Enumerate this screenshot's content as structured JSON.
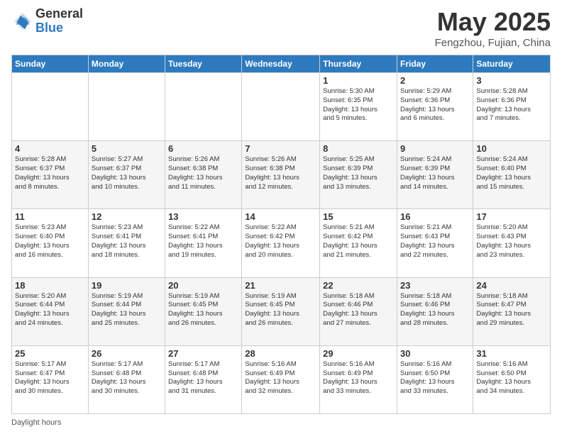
{
  "header": {
    "logo_general": "General",
    "logo_blue": "Blue",
    "title": "May 2025",
    "location": "Fengzhou, Fujian, China"
  },
  "weekdays": [
    "Sunday",
    "Monday",
    "Tuesday",
    "Wednesday",
    "Thursday",
    "Friday",
    "Saturday"
  ],
  "weeks": [
    [
      {
        "day": "",
        "info": ""
      },
      {
        "day": "",
        "info": ""
      },
      {
        "day": "",
        "info": ""
      },
      {
        "day": "",
        "info": ""
      },
      {
        "day": "1",
        "info": "Sunrise: 5:30 AM\nSunset: 6:35 PM\nDaylight: 13 hours\nand 5 minutes."
      },
      {
        "day": "2",
        "info": "Sunrise: 5:29 AM\nSunset: 6:36 PM\nDaylight: 13 hours\nand 6 minutes."
      },
      {
        "day": "3",
        "info": "Sunrise: 5:28 AM\nSunset: 6:36 PM\nDaylight: 13 hours\nand 7 minutes."
      }
    ],
    [
      {
        "day": "4",
        "info": "Sunrise: 5:28 AM\nSunset: 6:37 PM\nDaylight: 13 hours\nand 8 minutes."
      },
      {
        "day": "5",
        "info": "Sunrise: 5:27 AM\nSunset: 6:37 PM\nDaylight: 13 hours\nand 10 minutes."
      },
      {
        "day": "6",
        "info": "Sunrise: 5:26 AM\nSunset: 6:38 PM\nDaylight: 13 hours\nand 11 minutes."
      },
      {
        "day": "7",
        "info": "Sunrise: 5:26 AM\nSunset: 6:38 PM\nDaylight: 13 hours\nand 12 minutes."
      },
      {
        "day": "8",
        "info": "Sunrise: 5:25 AM\nSunset: 6:39 PM\nDaylight: 13 hours\nand 13 minutes."
      },
      {
        "day": "9",
        "info": "Sunrise: 5:24 AM\nSunset: 6:39 PM\nDaylight: 13 hours\nand 14 minutes."
      },
      {
        "day": "10",
        "info": "Sunrise: 5:24 AM\nSunset: 6:40 PM\nDaylight: 13 hours\nand 15 minutes."
      }
    ],
    [
      {
        "day": "11",
        "info": "Sunrise: 5:23 AM\nSunset: 6:40 PM\nDaylight: 13 hours\nand 16 minutes."
      },
      {
        "day": "12",
        "info": "Sunrise: 5:23 AM\nSunset: 6:41 PM\nDaylight: 13 hours\nand 18 minutes."
      },
      {
        "day": "13",
        "info": "Sunrise: 5:22 AM\nSunset: 6:41 PM\nDaylight: 13 hours\nand 19 minutes."
      },
      {
        "day": "14",
        "info": "Sunrise: 5:22 AM\nSunset: 6:42 PM\nDaylight: 13 hours\nand 20 minutes."
      },
      {
        "day": "15",
        "info": "Sunrise: 5:21 AM\nSunset: 6:42 PM\nDaylight: 13 hours\nand 21 minutes."
      },
      {
        "day": "16",
        "info": "Sunrise: 5:21 AM\nSunset: 6:43 PM\nDaylight: 13 hours\nand 22 minutes."
      },
      {
        "day": "17",
        "info": "Sunrise: 5:20 AM\nSunset: 6:43 PM\nDaylight: 13 hours\nand 23 minutes."
      }
    ],
    [
      {
        "day": "18",
        "info": "Sunrise: 5:20 AM\nSunset: 6:44 PM\nDaylight: 13 hours\nand 24 minutes."
      },
      {
        "day": "19",
        "info": "Sunrise: 5:19 AM\nSunset: 6:44 PM\nDaylight: 13 hours\nand 25 minutes."
      },
      {
        "day": "20",
        "info": "Sunrise: 5:19 AM\nSunset: 6:45 PM\nDaylight: 13 hours\nand 26 minutes."
      },
      {
        "day": "21",
        "info": "Sunrise: 5:19 AM\nSunset: 6:45 PM\nDaylight: 13 hours\nand 26 minutes."
      },
      {
        "day": "22",
        "info": "Sunrise: 5:18 AM\nSunset: 6:46 PM\nDaylight: 13 hours\nand 27 minutes."
      },
      {
        "day": "23",
        "info": "Sunrise: 5:18 AM\nSunset: 6:46 PM\nDaylight: 13 hours\nand 28 minutes."
      },
      {
        "day": "24",
        "info": "Sunrise: 5:18 AM\nSunset: 6:47 PM\nDaylight: 13 hours\nand 29 minutes."
      }
    ],
    [
      {
        "day": "25",
        "info": "Sunrise: 5:17 AM\nSunset: 6:47 PM\nDaylight: 13 hours\nand 30 minutes."
      },
      {
        "day": "26",
        "info": "Sunrise: 5:17 AM\nSunset: 6:48 PM\nDaylight: 13 hours\nand 30 minutes."
      },
      {
        "day": "27",
        "info": "Sunrise: 5:17 AM\nSunset: 6:48 PM\nDaylight: 13 hours\nand 31 minutes."
      },
      {
        "day": "28",
        "info": "Sunrise: 5:16 AM\nSunset: 6:49 PM\nDaylight: 13 hours\nand 32 minutes."
      },
      {
        "day": "29",
        "info": "Sunrise: 5:16 AM\nSunset: 6:49 PM\nDaylight: 13 hours\nand 33 minutes."
      },
      {
        "day": "30",
        "info": "Sunrise: 5:16 AM\nSunset: 6:50 PM\nDaylight: 13 hours\nand 33 minutes."
      },
      {
        "day": "31",
        "info": "Sunrise: 5:16 AM\nSunset: 6:50 PM\nDaylight: 13 hours\nand 34 minutes."
      }
    ]
  ],
  "footer": {
    "daylight_label": "Daylight hours"
  }
}
